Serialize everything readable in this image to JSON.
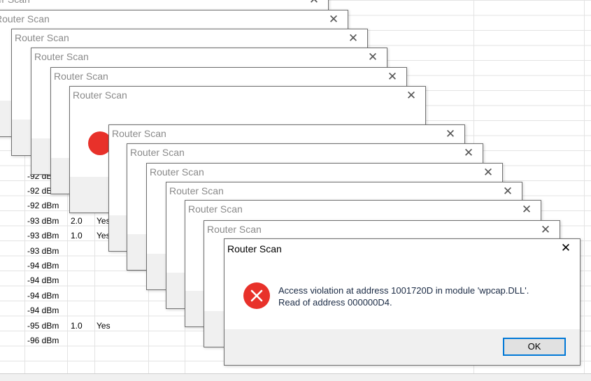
{
  "background_table": {
    "rows": [
      {
        "signal": "-92 dBm",
        "ver": "",
        "flag": ""
      },
      {
        "signal": "-92 dBm",
        "ver": "",
        "flag": ""
      },
      {
        "signal": "-92 dBm",
        "ver": "",
        "flag": ""
      },
      {
        "signal": "-93 dBm",
        "ver": "2.0",
        "flag": "Yes"
      },
      {
        "signal": "-93 dBm",
        "ver": "1.0",
        "flag": "Yes"
      },
      {
        "signal": "-93 dBm",
        "ver": "",
        "flag": ""
      },
      {
        "signal": "-94 dBm",
        "ver": "",
        "flag": ""
      },
      {
        "signal": "-94 dBm",
        "ver": "",
        "flag": ""
      },
      {
        "signal": "-94 dBm",
        "ver": "",
        "flag": ""
      },
      {
        "signal": "-94 dBm",
        "ver": "",
        "flag": ""
      },
      {
        "signal": "-95 dBm",
        "ver": "1.0",
        "flag": "Yes"
      },
      {
        "signal": "-96 dBm",
        "ver": "",
        "flag": ""
      }
    ]
  },
  "dialogs": {
    "title": "Router Scan",
    "close_glyph": "✕",
    "count_stacked": 12
  },
  "front_dialog": {
    "title": "Router Scan",
    "close_glyph": "✕",
    "message_line1": "Access violation at address 1001720D in module 'wpcap.DLL'.",
    "message_line2": "Read of address 000000D4.",
    "ok_label": "OK",
    "icon": "error-icon"
  },
  "colors": {
    "error_red": "#e8312a",
    "focus_blue": "#0078d7",
    "footer_gray": "#f0f0f0"
  }
}
